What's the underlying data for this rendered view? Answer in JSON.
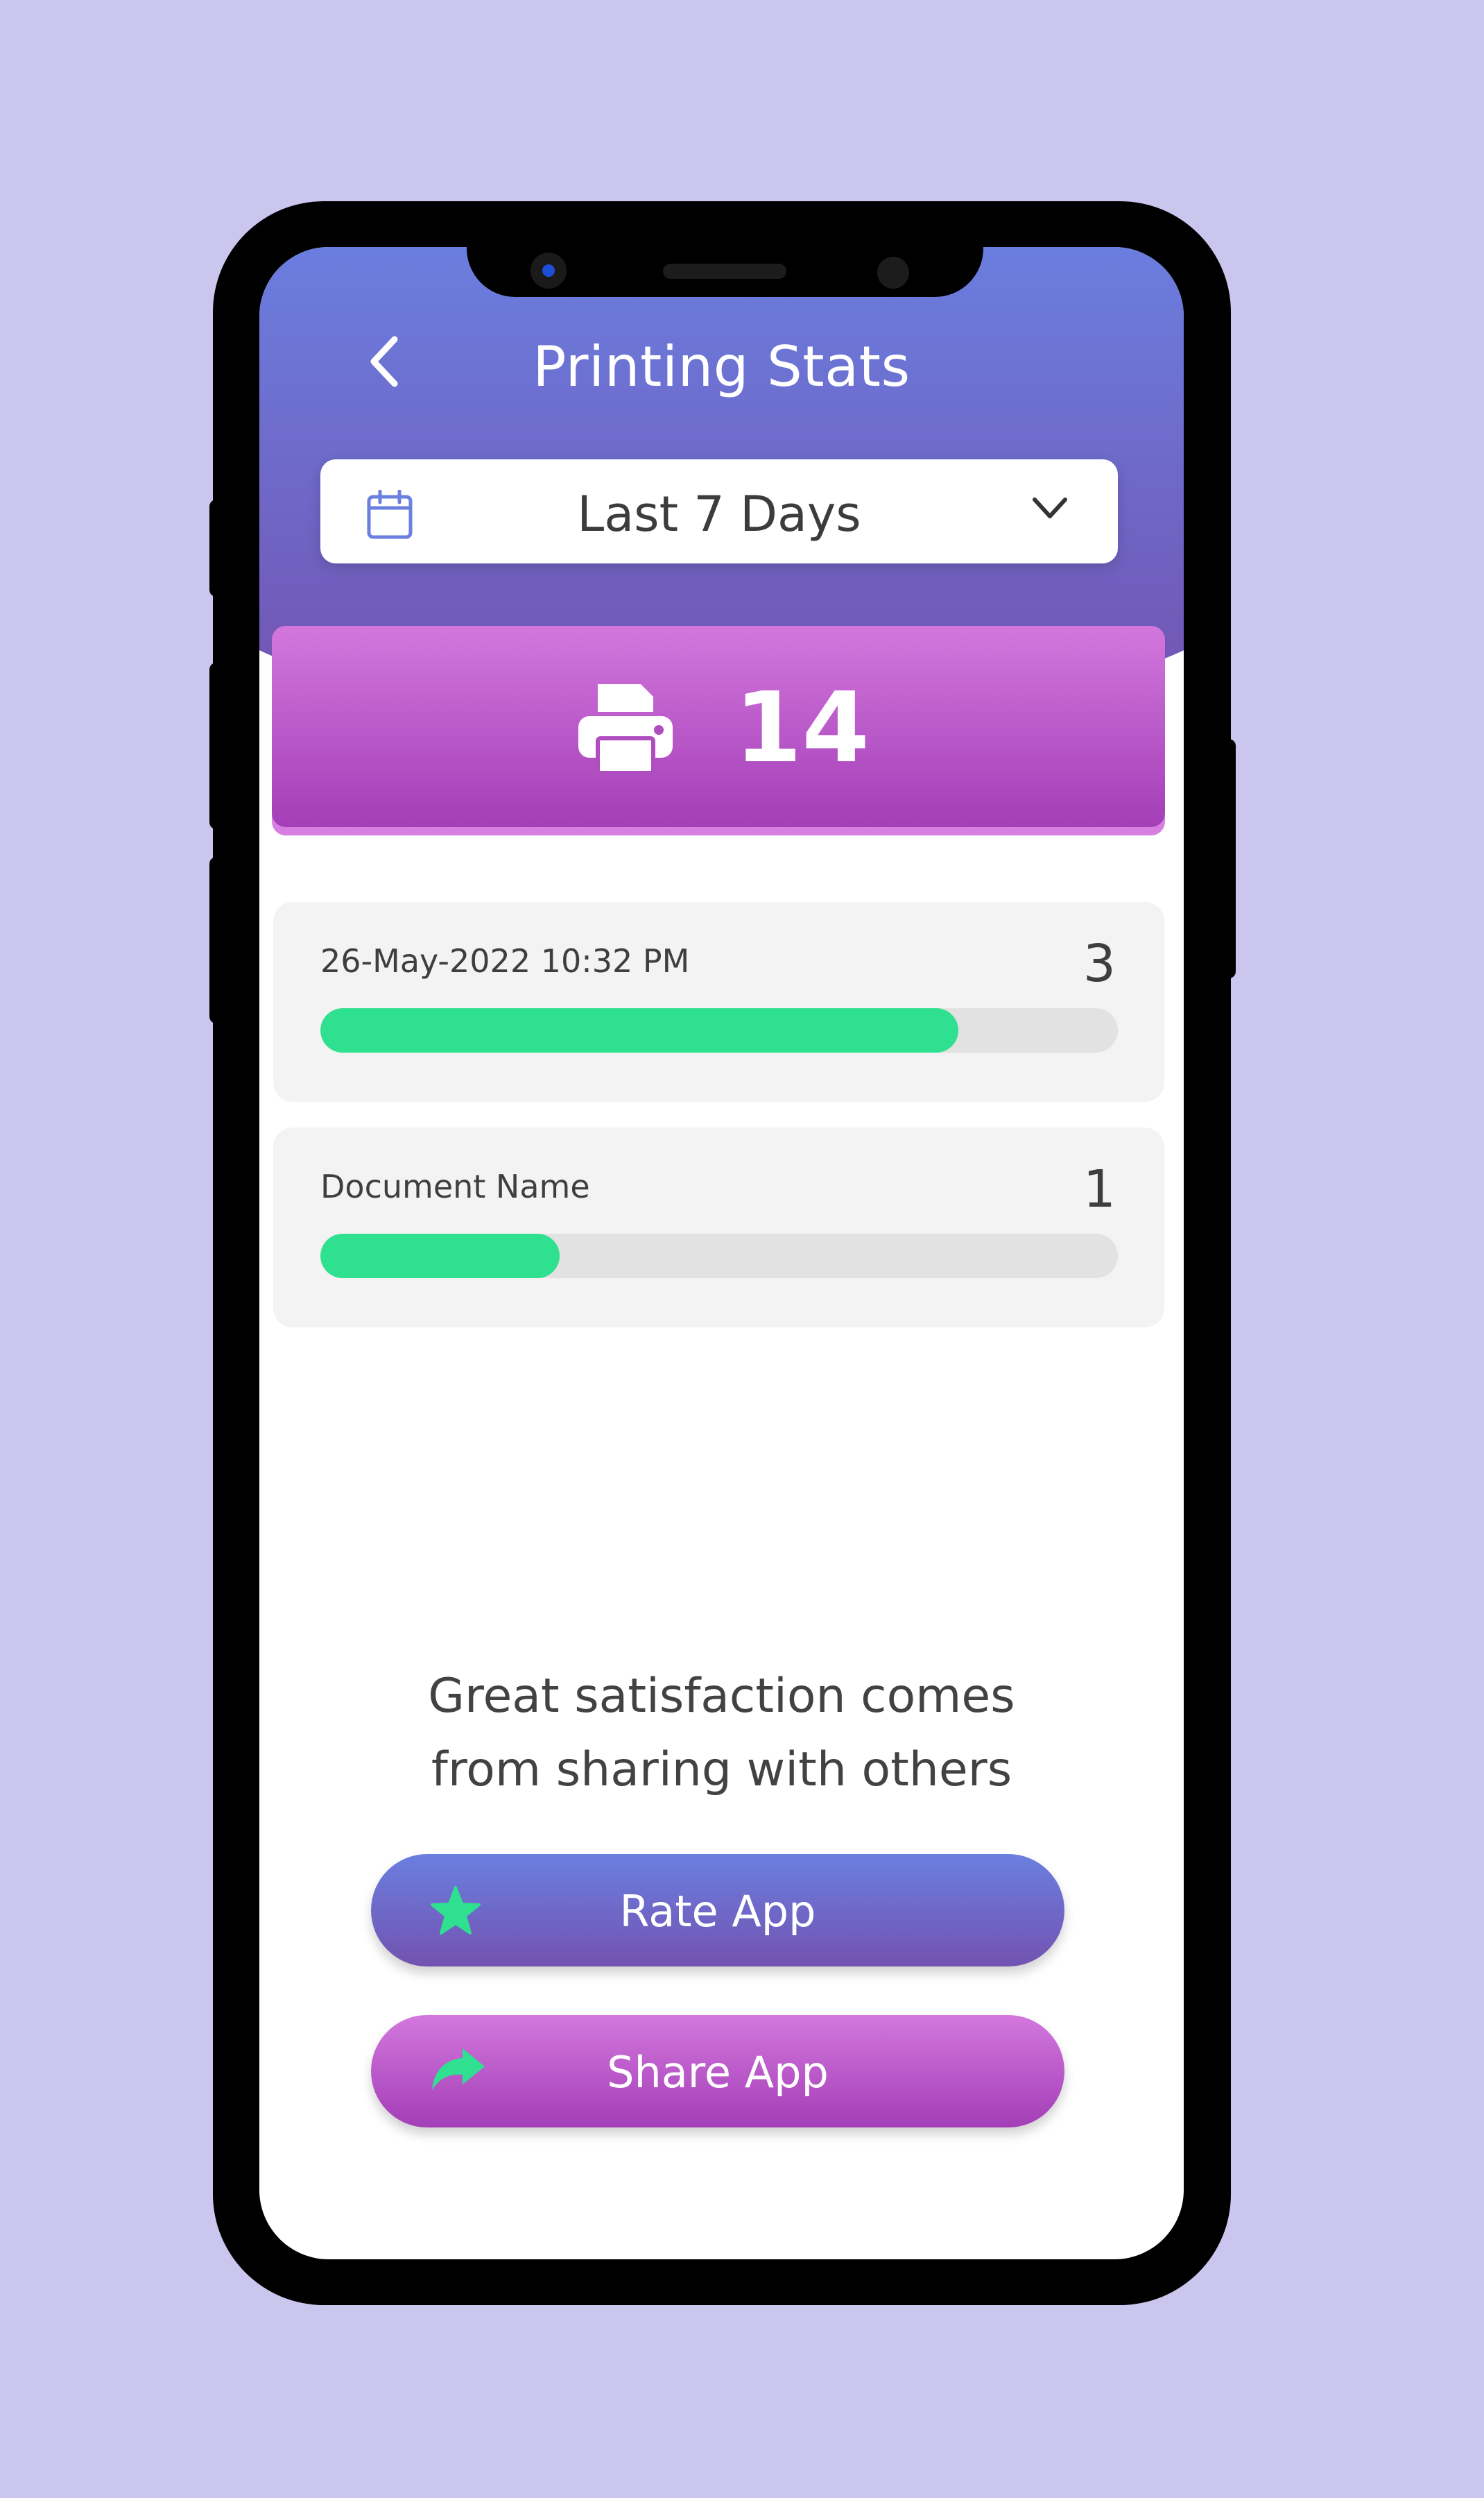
{
  "header": {
    "title": "Printing Stats",
    "back_icon": "chevron-left-icon"
  },
  "period_selector": {
    "icon": "calendar-icon",
    "value": "Last 7 Days",
    "dropdown_icon": "chevron-down-icon"
  },
  "total": {
    "icon": "printer-icon",
    "value": "14"
  },
  "stats": [
    {
      "name": "26-May-2022 10:32 PM",
      "count": "3",
      "progress": 0.8
    },
    {
      "name": "Document Name",
      "count": "1",
      "progress": 0.3
    }
  ],
  "quote": {
    "line1": "Great satisfaction comes",
    "line2": "from sharing with others"
  },
  "actions": {
    "rate_label": "Rate App",
    "rate_icon": "star-icon",
    "share_label": "Share App",
    "share_icon": "share-arrow-icon"
  },
  "colors": {
    "background": "#cbc6ee",
    "header_gradient_top": "#6a7fe0",
    "header_gradient_bottom": "#7352b0",
    "accent_purple_top": "#d377dd",
    "accent_purple_bottom": "#a33eb7",
    "progress_green": "#2ee08f"
  }
}
